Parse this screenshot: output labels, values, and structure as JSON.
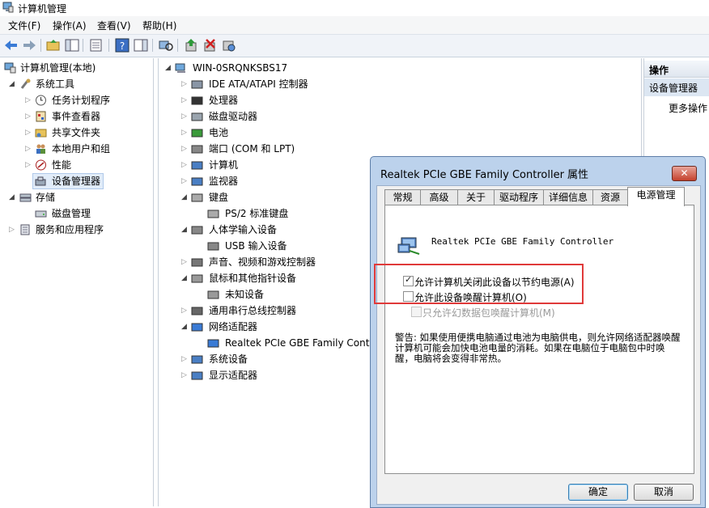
{
  "window": {
    "title": "计算机管理"
  },
  "menubar": {
    "items": [
      "文件(F)",
      "操作(A)",
      "查看(V)",
      "帮助(H)"
    ]
  },
  "tree": {
    "root": "计算机管理(本地)",
    "system_tools": "系统工具",
    "items": [
      "任务计划程序",
      "事件查看器",
      "共享文件夹",
      "本地用户和组",
      "性能",
      "设备管理器"
    ],
    "storage": "存储",
    "disk_mgmt": "磁盘管理",
    "services": "服务和应用程序"
  },
  "devices": {
    "computer": "WIN-0SRQNKSBS17",
    "list": [
      "IDE ATA/ATAPI 控制器",
      "处理器",
      "磁盘驱动器",
      "电池",
      "端口 (COM 和 LPT)",
      "计算机",
      "监视器",
      "键盘",
      "PS/2 标准键盘",
      "人体学输入设备",
      "USB 输入设备",
      "声音、视频和游戏控制器",
      "鼠标和其他指针设备",
      "未知设备",
      "通用串行总线控制器",
      "网络适配器",
      "Realtek PCIe GBE Family Controller",
      "系统设备",
      "显示适配器"
    ]
  },
  "actions": {
    "header": "操作",
    "section": "设备管理器",
    "more": "更多操作"
  },
  "dialog": {
    "title": "Realtek PCIe GBE Family Controller 属性",
    "close": "✕",
    "tabs": [
      "常规",
      "高级",
      "关于",
      "驱动程序",
      "详细信息",
      "资源",
      "电源管理"
    ],
    "device_name": "Realtek PCIe GBE Family Controller",
    "options": [
      {
        "label": "允许计算机关闭此设备以节约电源(A)",
        "checked": true,
        "enabled": true
      },
      {
        "label": "允许此设备唤醒计算机(O)",
        "checked": false,
        "enabled": true
      },
      {
        "label": "只允许幻数据包唤醒计算机(M)",
        "checked": false,
        "enabled": false
      }
    ],
    "warning": "警告: 如果使用便携电脑通过电池为电脑供电，则允许网络适配器唤醒计算机可能会加快电池电量的消耗。如果在电脑位于电脑包中时唤醒，电脑将会变得非常热。",
    "ok": "确定",
    "cancel": "取消"
  },
  "colors": {
    "highlight_box": "#e03a3a",
    "dialog_frame": "#bcd2ec",
    "selection": "#e1ecf9"
  }
}
